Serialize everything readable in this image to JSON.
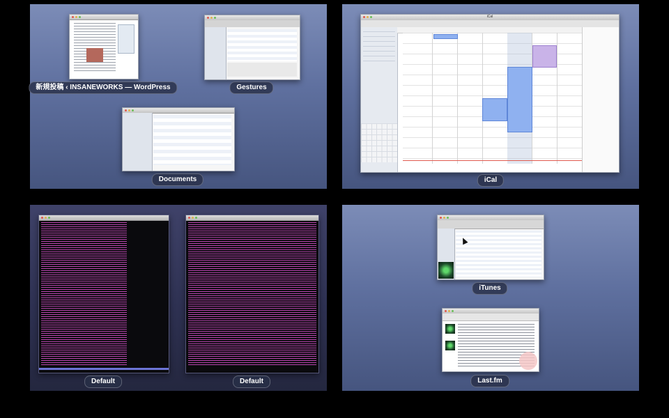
{
  "spaces": {
    "top_left": {
      "windows": [
        {
          "title": "新規投稿 ‹ INSANEWORKS — WordPress"
        },
        {
          "title": "Gestures"
        },
        {
          "title": "Documents"
        }
      ]
    },
    "top_right": {
      "windows": [
        {
          "title": "iCal",
          "window_title": "iCal"
        }
      ]
    },
    "bottom_left": {
      "windows": [
        {
          "title": "Default"
        },
        {
          "title": "Default"
        }
      ]
    },
    "bottom_right": {
      "windows": [
        {
          "title": "iTunes"
        },
        {
          "title": "Last.fm"
        }
      ]
    }
  },
  "colors": {
    "space_background": "#6b7ba8",
    "label_background": "#283048",
    "terminal_text": "#d64fc9",
    "ical_event": "#8fb1f0",
    "ical_event_purple": "#c9b3e8"
  }
}
